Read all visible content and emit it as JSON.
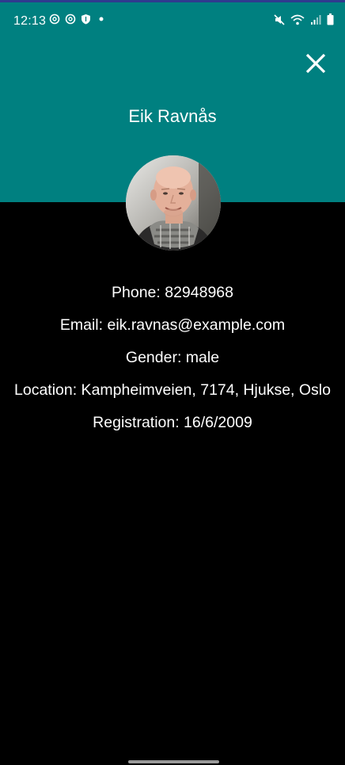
{
  "status_bar": {
    "time": "12:13",
    "left_icons": [
      "sync-icon",
      "sync-icon",
      "shield-icon",
      "dot-icon"
    ],
    "right_icons": [
      "mute-icon",
      "wifi-icon",
      "signal-icon",
      "battery-icon"
    ]
  },
  "header": {
    "name": "Eik Ravnås",
    "close_icon": "close-icon",
    "background_color": "#008080"
  },
  "avatar": {
    "description_icon": "user-photo"
  },
  "details": {
    "phone": "Phone: 82948968",
    "email": "Email: eik.ravnas@example.com",
    "gender": "Gender: male",
    "location": "Location: Kampheimveien, 7174, Hjukse, Oslo",
    "registration": "Registration: 16/6/2009"
  }
}
